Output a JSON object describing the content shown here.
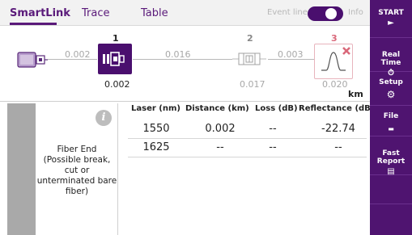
{
  "tabs": [
    {
      "label": "SmartLink",
      "active": true
    },
    {
      "label": "Trace",
      "active": false
    },
    {
      "label": "Table",
      "active": false
    }
  ],
  "event_line": {
    "label": "Event line",
    "info_label": "Info",
    "toggle_on": true
  },
  "diagram": {
    "segment_distances": [
      "0.002",
      "0.016",
      "0.003"
    ],
    "events": [
      {
        "number": "1",
        "position": "0.002",
        "type": "connector",
        "selected": true
      },
      {
        "number": "2",
        "position": "0.017",
        "type": "splice",
        "selected": false
      },
      {
        "number": "3",
        "position": "0.020",
        "type": "fiber-end",
        "selected": false,
        "fail": true
      }
    ],
    "unit": "km"
  },
  "event_info": {
    "icon": "info-icon",
    "text": "Fiber End\n(Possible break,\ncut or\nunterminated bare\nfiber)"
  },
  "results": {
    "headers": [
      "Laser (nm)",
      "Distance (km)",
      "Loss  (dB)",
      "Reflectance (dB)"
    ],
    "rows": [
      [
        "1550",
        "0.002",
        "--",
        "-22.74"
      ],
      [
        "1625",
        "--",
        "--",
        "--"
      ]
    ]
  },
  "menu": [
    {
      "label": "START",
      "icon": "play-icon",
      "glyph": "►"
    },
    {
      "label": "Real\nTime",
      "icon": "timer-icon",
      "glyph": "⏱"
    },
    {
      "label": "Setup",
      "icon": "gear-icon",
      "glyph": "⚙"
    },
    {
      "label": "File",
      "icon": "folder-icon",
      "glyph": "▬"
    },
    {
      "label": "Fast\nReport",
      "icon": "report-icon",
      "glyph": "▤"
    }
  ],
  "colors": {
    "accent": "#4f1470",
    "selected_event": "#4a0f6e",
    "fail": "#d9687a",
    "neutral_line": "#b8b8b8"
  }
}
